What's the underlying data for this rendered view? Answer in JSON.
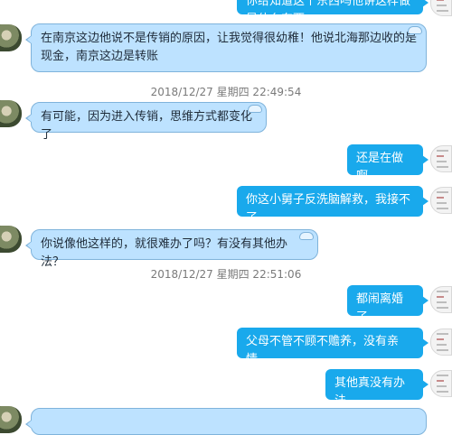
{
  "messages": {
    "top_partial": "你给知道这个东西吗他讲这样做是什么东西",
    "m1": "在南京这边他说不是传销的原因，让我觉得很幼稚！他说北海那边收的是现金，南京这边是转账",
    "ts1": "2018/12/27 星期四 22:49:54",
    "m2": "有可能，因为进入传销，思维方式都变化了",
    "m3": "还是在做啊",
    "m4": "你这小舅子反洗脑解救，我接不了",
    "m5": "你说像他这样的，就很难办了吗？有没有其他办法？",
    "ts2": "2018/12/27 星期四 22:51:06",
    "m6": "都闹离婚了",
    "m7": "父母不管不顾不赡养，没有亲情，",
    "m8": "其他真没有办法"
  },
  "colors": {
    "incoming_bubble": "#bde2ff",
    "outgoing_bubble": "#19a9ec",
    "timestamp_text": "#7a7a7a"
  },
  "icons": {
    "incoming_avatar": "user-photo-avatar",
    "outgoing_avatar": "document-thumbnail-avatar",
    "bubble_decoration": "cloud-icon"
  }
}
